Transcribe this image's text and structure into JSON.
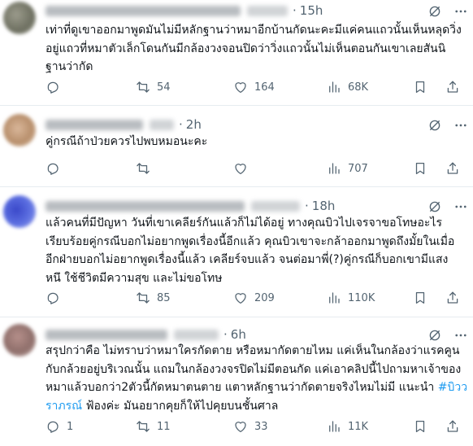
{
  "tweets": [
    {
      "time": "15h",
      "text": "เท่าที่ดูเขาออกมาพูดมันไม่มีหลักฐานว่าหมาอีกบ้านกัดนะคะมีแค่คนแถวนั้นเห็นหลุดวิ่ง\nอยู่แถวที่หมาตัวเล็กโดนกันมีกล้องวงจอนปิดว่าวิ่งแถวนั้นไม่เห็นตอนกันเขาเลยสันนิ\nฐานว่ากัด",
      "replies": "",
      "reposts": "54",
      "likes": "164",
      "views": "68K"
    },
    {
      "time": "2h",
      "text": "คู่กรณีถ้าป่วยควรไปพบหมอนะคะ",
      "replies": "",
      "reposts": "",
      "likes": "",
      "views": "707"
    },
    {
      "time": "18h",
      "text": "แล้วคนที่มีปัญหา วันที่เขาเคลียร์กันแล้วก็ไม่ได้อยู่ ทางคุณบิวไปเจรจาขอโทษอะไร\nเรียบร้อยคู่กรณีบอกไม่อยากพูดเรื่องนี้อีกแล้ว คุณบิวเขาจะกล้าออกมาพูดถึงมั้ยในเมื่อ\nอีกฝ่ายบอกไม่อยากพูดเรื่องนี้แล้ว เคลียร์จบแล้ว จนต่อมาพี่(?)คู่กรณีก็บอกเขามีแสง\nหนึ ใช้ชีวิตมีความสุข และไม่ขอโทษ",
      "replies": "",
      "reposts": "85",
      "likes": "209",
      "views": "110K"
    },
    {
      "time": "6h",
      "text_plain": "สรุปกว่าคือ ไม่ทราบว่าหมาใครกัดตาย หรือหมากัดตายไหม แค่เห็นในกล้องว่าแรคคูน\nกับกล้วยอยู่บริเวณนั้น แถมในกล้องวงจรปิดไม่มีตอนกัด แค่เอาคลิปนี้ไปถามหาเจ้าของ\nหมาแล้วบอกว่า2ตัวนี้กัดหมาตนตาย แตาหลักฐานว่ากัดตายจริงไหมไม่มี แนะนำ ",
      "hashtag": "#บิวว\nราภรณ์",
      "text_tail": " ฟ้องค่ะ มันอยากคุยก็ให้ไปคุยบนชั้นศาล",
      "replies": "1",
      "reposts": "11",
      "likes": "33",
      "views": "11K"
    }
  ],
  "icons": {
    "reply": "reply-icon",
    "repost": "repost-icon",
    "like": "heart-icon",
    "views": "views-chart-icon",
    "share": "share-icon",
    "grok": "grok-icon",
    "more": "more-icon"
  },
  "colors": {
    "text": "#0f1419",
    "muted": "#536471",
    "link": "#1d9bf0",
    "divider": "#e6ecf0"
  }
}
